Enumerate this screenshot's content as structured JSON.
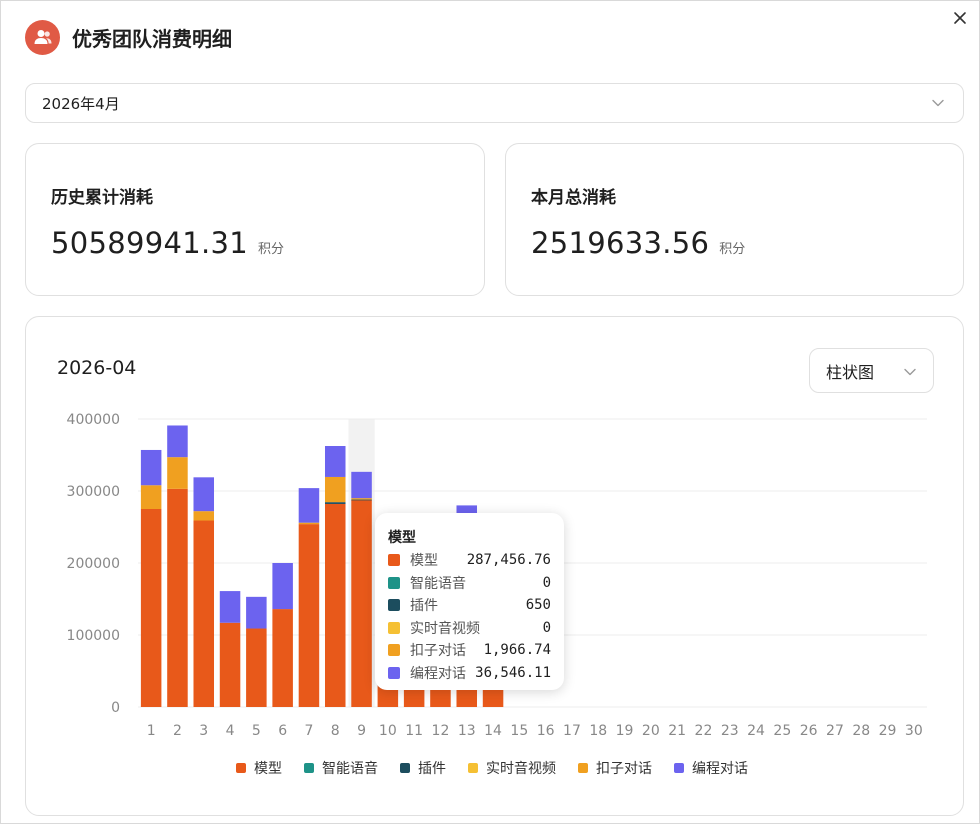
{
  "header": {
    "title": "优秀团队消费明细",
    "avatar_icon": "team-users-icon"
  },
  "month_select": {
    "value": "2026年4月"
  },
  "stats": {
    "history": {
      "label": "历史累计消耗",
      "value": "50589941.31",
      "unit": "积分"
    },
    "month": {
      "label": "本月总消耗",
      "value": "2519633.56",
      "unit": "积分"
    }
  },
  "chart_card": {
    "title": "2026-04",
    "type_select": "柱状图"
  },
  "colors": {
    "模型": "#e8591a",
    "智能语音": "#1e9388",
    "插件": "#1c4d5e",
    "实时音视频": "#f5c034",
    "扣子对话": "#f0a020",
    "编程对话": "#6c63ef"
  },
  "tooltip": {
    "title": "模型",
    "rows": [
      {
        "name": "模型",
        "value": "287,456.76"
      },
      {
        "name": "智能语音",
        "value": "0"
      },
      {
        "name": "插件",
        "value": "650"
      },
      {
        "name": "实时音视频",
        "value": "0"
      },
      {
        "name": "扣子对话",
        "value": "1,966.74"
      },
      {
        "name": "编程对话",
        "value": "36,546.11"
      }
    ]
  },
  "chart_data": {
    "type": "bar",
    "stacked": true,
    "title": "2026-04",
    "categories": [
      "1",
      "2",
      "3",
      "4",
      "5",
      "6",
      "7",
      "8",
      "9",
      "10",
      "11",
      "12",
      "13",
      "14",
      "15",
      "16",
      "17",
      "18",
      "19",
      "20",
      "21",
      "22",
      "23",
      "24",
      "25",
      "26",
      "27",
      "28",
      "29",
      "30"
    ],
    "ylim": [
      0,
      400000
    ],
    "yticks": [
      0,
      100000,
      200000,
      300000,
      400000
    ],
    "grid": true,
    "legend": "bottom",
    "highlight_category": "9",
    "series": [
      {
        "name": "模型",
        "values": [
          275000,
          303000,
          259000,
          117000,
          109000,
          136000,
          254000,
          282000,
          287456.76,
          150000,
          140000,
          145000,
          230000,
          110000,
          0,
          0,
          0,
          0,
          0,
          0,
          0,
          0,
          0,
          0,
          0,
          0,
          0,
          0,
          0,
          0
        ]
      },
      {
        "name": "智能语音",
        "values": [
          0,
          0,
          0,
          0,
          0,
          0,
          0,
          0,
          0,
          0,
          0,
          0,
          0,
          0,
          0,
          0,
          0,
          0,
          0,
          0,
          0,
          0,
          0,
          0,
          0,
          0,
          0,
          0,
          0,
          0
        ]
      },
      {
        "name": "插件",
        "values": [
          0,
          0,
          0,
          0,
          0,
          0,
          0,
          2500,
          650,
          0,
          0,
          0,
          0,
          0,
          0,
          0,
          0,
          0,
          0,
          0,
          0,
          0,
          0,
          0,
          0,
          0,
          0,
          0,
          0,
          0
        ]
      },
      {
        "name": "实时音视频",
        "values": [
          0,
          0,
          0,
          0,
          0,
          0,
          0,
          0,
          0,
          0,
          0,
          0,
          0,
          0,
          0,
          0,
          0,
          0,
          0,
          0,
          0,
          0,
          0,
          0,
          0,
          0,
          0,
          0,
          0,
          0
        ]
      },
      {
        "name": "扣子对话",
        "values": [
          33000,
          44000,
          13000,
          0,
          0,
          0,
          2000,
          35000,
          1966.74,
          0,
          0,
          0,
          30000,
          0,
          0,
          0,
          0,
          0,
          0,
          0,
          0,
          0,
          0,
          0,
          0,
          0,
          0,
          0,
          0,
          0
        ]
      },
      {
        "name": "编程对话",
        "values": [
          49000,
          44000,
          47000,
          44000,
          44000,
          64000,
          48000,
          43000,
          36546.11,
          40000,
          35000,
          38000,
          20000,
          30000,
          0,
          0,
          0,
          0,
          0,
          0,
          0,
          0,
          0,
          0,
          0,
          0,
          0,
          0,
          0,
          0
        ]
      }
    ]
  }
}
